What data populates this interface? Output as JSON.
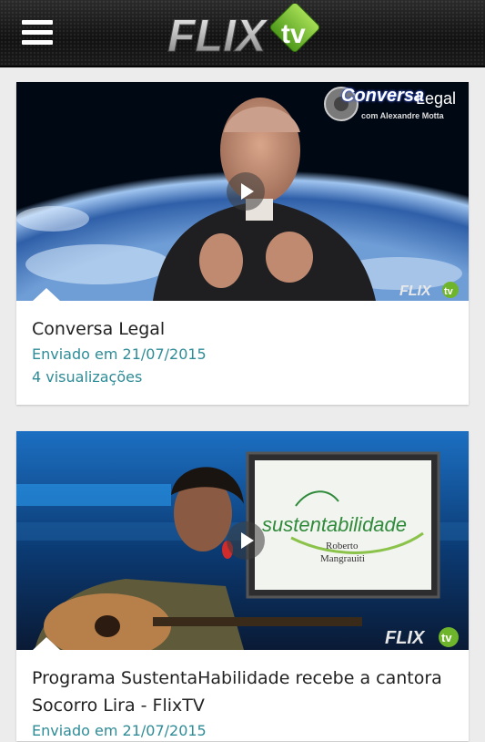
{
  "header": {
    "menu_icon": "hamburger-menu-icon",
    "logo_text_left": "FLIX",
    "logo_text_right": "tv",
    "logo_colors": {
      "silver": "#c9c9c9",
      "green": "#6fb52c"
    }
  },
  "videos": [
    {
      "title": "Conversa Legal",
      "date": "Enviado em 21/07/2015",
      "views": "4 visualizações",
      "show_logo": {
        "line1": "Conversa",
        "line2": "Legal",
        "subtitle": "com Alexandre Motta"
      }
    },
    {
      "title": "Programa SustentaHabilidade recebe a cantora Socorro Lira - FlixTV",
      "date": "Enviado em 21/07/2015",
      "screen_logo": {
        "text": "sustentabilidade",
        "name_line1": "Roberto",
        "name_line2": "Mangrauiti"
      }
    }
  ],
  "watermark": {
    "text_left": "FLIX",
    "text_right": "tv"
  },
  "accent_color": "#2e8c97"
}
